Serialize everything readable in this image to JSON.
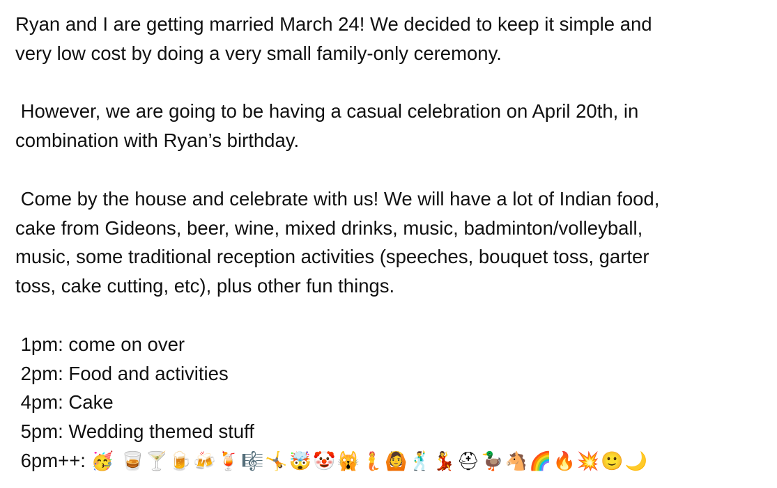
{
  "paragraphs": [
    [
      "Ryan and I are getting married March 24! We decided to keep it simple and",
      "very low cost by doing a very small family-only ceremony."
    ],
    [
      " However, we are going to be having a casual celebration on April 20th, in",
      "combination with Ryan’s birthday."
    ],
    [
      " Come by the house and celebrate with us! We will have a lot of Indian food,",
      "cake from Gideons, beer, wine, mixed drinks, music, badminton/volleyball,",
      "music, some traditional reception activities (speeches, bouquet toss, garter",
      "toss, cake cutting, etc), plus other fun things."
    ]
  ],
  "schedule": [
    " 1pm: come on over",
    " 2pm: Food and activities",
    " 4pm: Cake",
    " 5pm: Wedding themed stuff"
  ],
  "last_line": {
    "label": " 6pm++: ",
    "emojis": "🥳 🥃🍸🍺🍻🍹🎼🤸🤯🤡🙀🧜🙆🕺💃⛑🦆🐴🌈🔥💥🙂🌙"
  }
}
